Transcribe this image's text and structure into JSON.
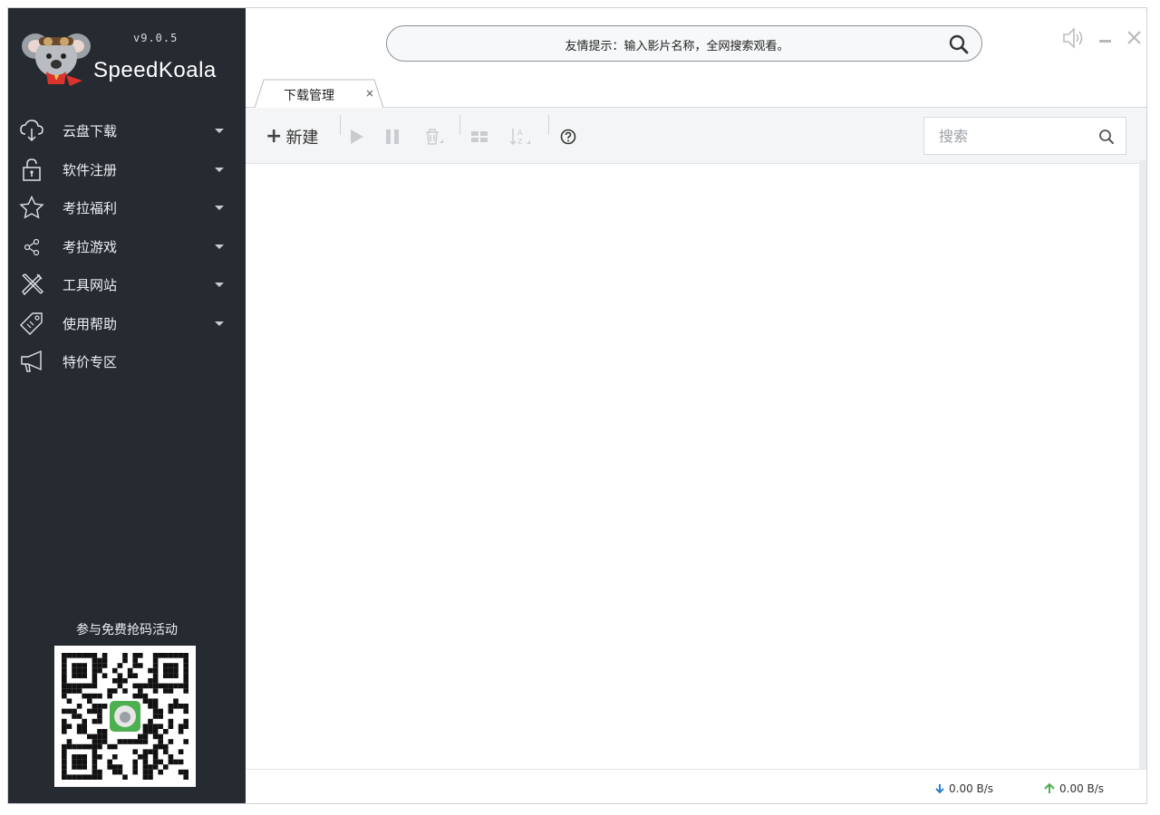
{
  "app": {
    "version": "v9.0.5",
    "name": "SpeedKoala"
  },
  "search": {
    "hint": "友情提示：输入影片名称，全网搜索观看。"
  },
  "window_controls": [
    "speaker-icon",
    "minimize-icon",
    "close-icon"
  ],
  "tabs": [
    {
      "label": "下载管理",
      "close": "×"
    }
  ],
  "sidebar": {
    "items": [
      {
        "label": "云盘下载",
        "icon": "cloud-download-icon",
        "expandable": true
      },
      {
        "label": "软件注册",
        "icon": "lock-icon",
        "expandable": true
      },
      {
        "label": "考拉福利",
        "icon": "star-icon",
        "expandable": true
      },
      {
        "label": "考拉游戏",
        "icon": "share-icon",
        "expandable": true
      },
      {
        "label": "工具网站",
        "icon": "tools-icon",
        "expandable": true
      },
      {
        "label": "使用帮助",
        "icon": "tag-icon",
        "expandable": true
      },
      {
        "label": "特价专区",
        "icon": "megaphone-icon",
        "expandable": false
      }
    ],
    "promo": "参与免费抢码活动"
  },
  "toolbar": {
    "new_label": "新建",
    "search_placeholder": "搜索",
    "icons": [
      "play-icon",
      "pause-icon",
      "delete-icon",
      "grid-view-icon",
      "sort-icon",
      "help-icon"
    ]
  },
  "status": {
    "download_speed": "0.00 B/s",
    "upload_speed": "0.00 B/s"
  },
  "colors": {
    "sidebar_bg": "#262a31",
    "download_arrow": "#2a7fd4",
    "upload_arrow": "#4caf50"
  }
}
